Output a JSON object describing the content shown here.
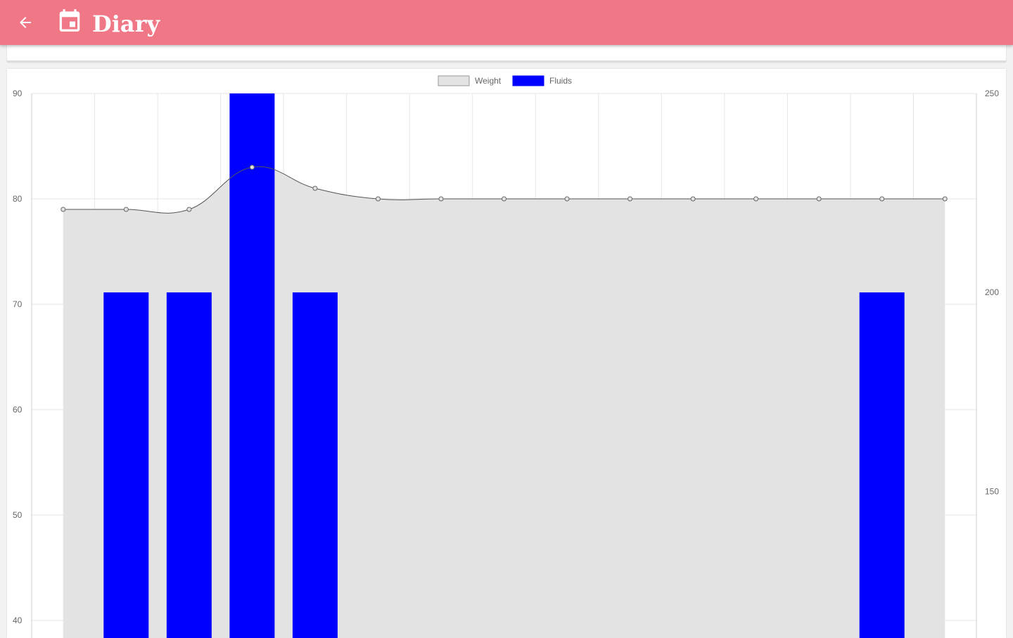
{
  "header": {
    "title": "Diary",
    "back_icon": "arrow-left-icon",
    "calendar_icon": "calendar-icon",
    "background": "#f07886"
  },
  "chart_data": {
    "type": "bar",
    "categories": [
      "",
      "",
      "",
      "",
      "",
      "",
      "",
      "",
      "",
      "",
      "",
      "",
      "",
      "",
      ""
    ],
    "legend": [
      "Weight",
      "Fluids"
    ],
    "series": [
      {
        "name": "Weight",
        "type": "area",
        "axis": "left",
        "color": "#e3e3e3",
        "line_color": "#555555",
        "values": [
          79,
          79,
          79,
          83,
          81,
          80,
          80,
          80,
          80,
          80,
          80,
          80,
          80,
          80,
          80
        ]
      },
      {
        "name": "Fluids",
        "type": "bar",
        "axis": "right",
        "color": "#0000ff",
        "values": [
          0,
          200,
          200,
          250,
          200,
          0,
          0,
          0,
          0,
          0,
          0,
          0,
          0,
          200,
          0
        ]
      }
    ],
    "y_left": {
      "ticks": [
        "90",
        "80",
        "70",
        "60",
        "50",
        "40"
      ],
      "range": [
        40,
        90
      ]
    },
    "y_right": {
      "ticks": [
        "250",
        "200",
        "150"
      ],
      "range": [
        107.5,
        250
      ]
    },
    "grid": true,
    "legend_position": "top"
  }
}
